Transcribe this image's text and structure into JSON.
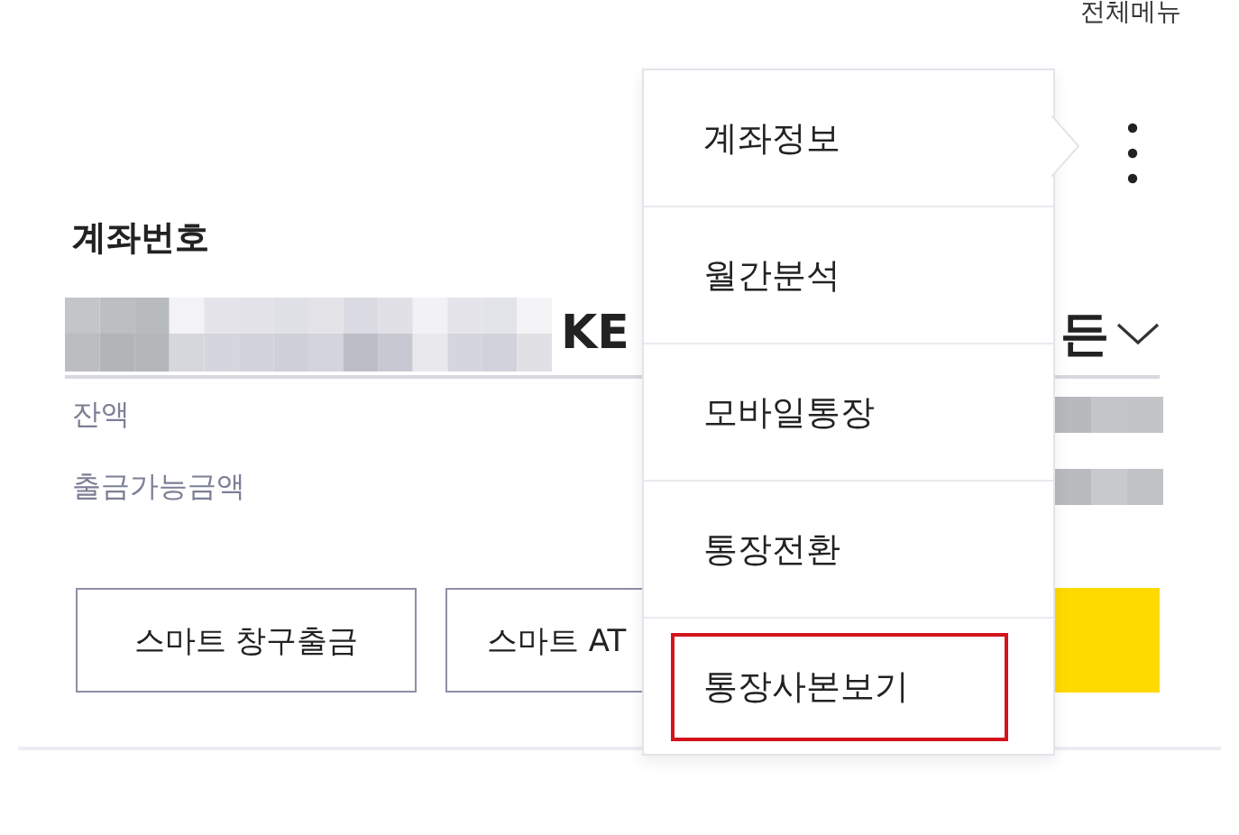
{
  "header": {
    "menu_link": "전체메뉴"
  },
  "account": {
    "label": "계좌번호",
    "number_visible": "KE",
    "number_end": "든"
  },
  "balances": [
    {
      "label": "잔액"
    },
    {
      "label": "출금가능금액"
    }
  ],
  "buttons": [
    {
      "label": "스마트 창구출금",
      "kind": "outline"
    },
    {
      "label": "스마트 AT",
      "kind": "outline"
    },
    {
      "kind": "primary"
    }
  ],
  "popup_menu": {
    "items": [
      {
        "label": "계좌정보",
        "highlighted": false
      },
      {
        "label": "월간분석",
        "highlighted": false
      },
      {
        "label": "모바일통장",
        "highlighted": false
      },
      {
        "label": "통장전환",
        "highlighted": false
      },
      {
        "label": "통장사본보기",
        "highlighted": true
      }
    ]
  }
}
